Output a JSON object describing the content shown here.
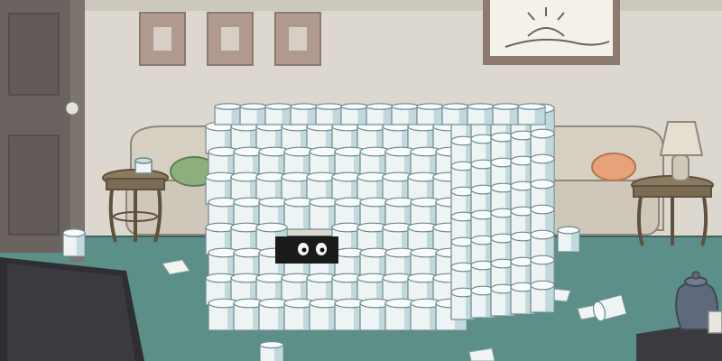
{
  "scene": {
    "description_text": "",
    "palette": {
      "wall": "#dcd8cf",
      "wall_shadow": "#c9c4b8",
      "floor": "#5d8f89",
      "floor_dark": "#4a7a74",
      "door": "#6b6360",
      "door_dark": "#544e4b",
      "frame": "#b09a90",
      "roll": "#eef3f3",
      "roll_shade": "#9cc3c9",
      "roll_core": "#c7dde0",
      "couch": "#d6d0c3",
      "couch_shadow": "#b9b2a3",
      "table_wood": "#8c7a5e",
      "tv": "#2f2f33",
      "vase": "#5e6a7c",
      "pillow_green": "#8bb07b",
      "pillow_orange": "#e8a27a",
      "lamp": "#e6dfcf"
    },
    "icons": [
      "door",
      "picture-frame",
      "couch",
      "side-table",
      "lamp",
      "vase",
      "tv",
      "toilet-paper-roll",
      "eyes"
    ]
  }
}
